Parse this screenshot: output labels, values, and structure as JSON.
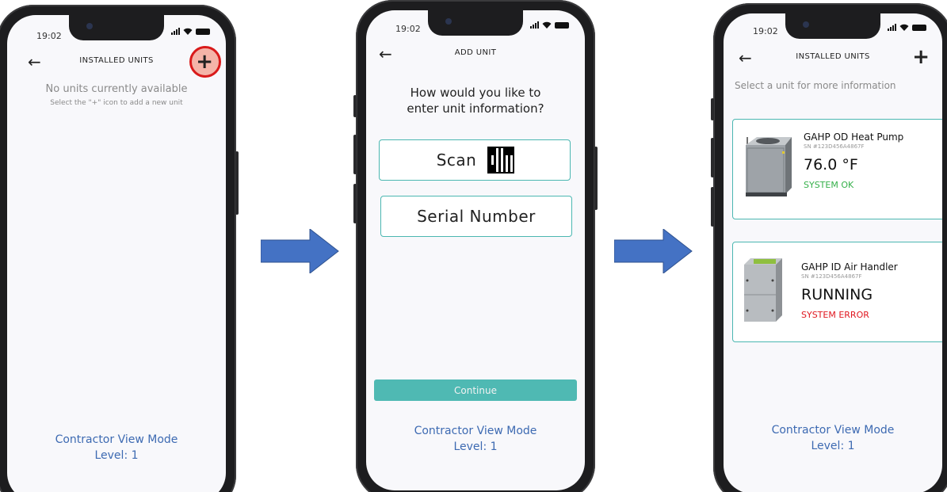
{
  "status_bar": {
    "time": "19:02"
  },
  "screen1": {
    "title": "INSTALLED UNITS",
    "add_label": "+",
    "empty_message": "No units currently available",
    "empty_hint": "Select the \"+\" icon to add a new unit",
    "footer_mode": "Contractor View Mode",
    "footer_level": "Level: 1"
  },
  "screen2": {
    "title": "ADD UNIT",
    "question_line1": "How would you like to",
    "question_line2": "enter unit information?",
    "scan_label": "Scan",
    "serial_label": "Serial Number",
    "continue_label": "Continue",
    "footer_mode": "Contractor View Mode",
    "footer_level": "Level: 1"
  },
  "screen3": {
    "title": "INSTALLED UNITS",
    "add_label": "+",
    "select_hint": "Select a unit for more information",
    "units": [
      {
        "name": "GAHP OD Heat Pump",
        "sn": "SN #123D456A4867F",
        "value": "76.0 °F",
        "status": "SYSTEM OK",
        "status_color": "#35b04a"
      },
      {
        "name": "GAHP ID Air Handler",
        "sn": "SN #123D456A4867F",
        "value": "RUNNING",
        "status": "SYSTEM ERROR",
        "status_color": "#e0171f"
      }
    ],
    "footer_mode": "Contractor View Mode",
    "footer_level": "Level: 1"
  },
  "colors": {
    "accent": "#4bb7b1",
    "link": "#3d6ab2",
    "arrow": "#4472c4",
    "highlight_ring": "#d91a1a"
  }
}
